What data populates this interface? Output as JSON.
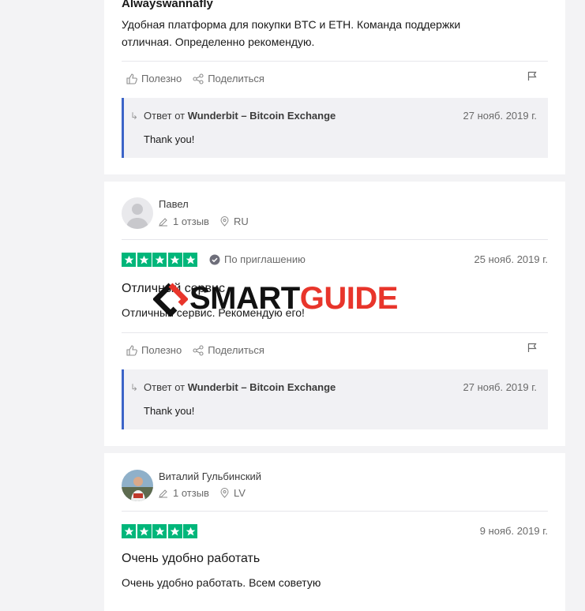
{
  "reviews": [
    {
      "author": "Alwayswannafly",
      "text": "Удобная платформа для покупки BTC и ETH. Команда поддержки отличная. Определенно рекомендую.",
      "useful_label": "Полезно",
      "share_label": "Поделиться",
      "reply": {
        "prefix": "Ответ от ",
        "company": "Wunderbit – Bitcoin Exchange",
        "date": "27 нояб. 2019 г.",
        "text": "Thank you!"
      }
    },
    {
      "author": "Павел",
      "reviews_count": "1 отзыв",
      "country": "RU",
      "rating": 5,
      "invited_label": "По приглашению",
      "date": "25 нояб. 2019 г.",
      "title": "Отличный сервис",
      "text": "Отличный сервис. Рекомендую его!",
      "useful_label": "Полезно",
      "share_label": "Поделиться",
      "reply": {
        "prefix": "Ответ от ",
        "company": "Wunderbit – Bitcoin Exchange",
        "date": "27 нояб. 2019 г.",
        "text": "Thank you!"
      }
    },
    {
      "author": "Виталий Гульбинский",
      "reviews_count": "1 отзыв",
      "country": "LV",
      "rating": 5,
      "date": "9 нояб. 2019 г.",
      "title": "Очень удобно работать",
      "text": "Очень удобно работать. Всем советую"
    }
  ],
  "watermark": {
    "part1": "SMART",
    "part2": "GUIDE"
  },
  "colors": {
    "star_green": "#00b67a",
    "reply_border": "#3c64c8",
    "watermark_red": "#e8352b",
    "watermark_black": "#111111"
  },
  "icons": [
    "thumbs-up-icon",
    "share-icon",
    "flag-icon",
    "reply-arrow-icon",
    "pencil-icon",
    "location-pin-icon",
    "verified-check-icon",
    "star-icon"
  ]
}
